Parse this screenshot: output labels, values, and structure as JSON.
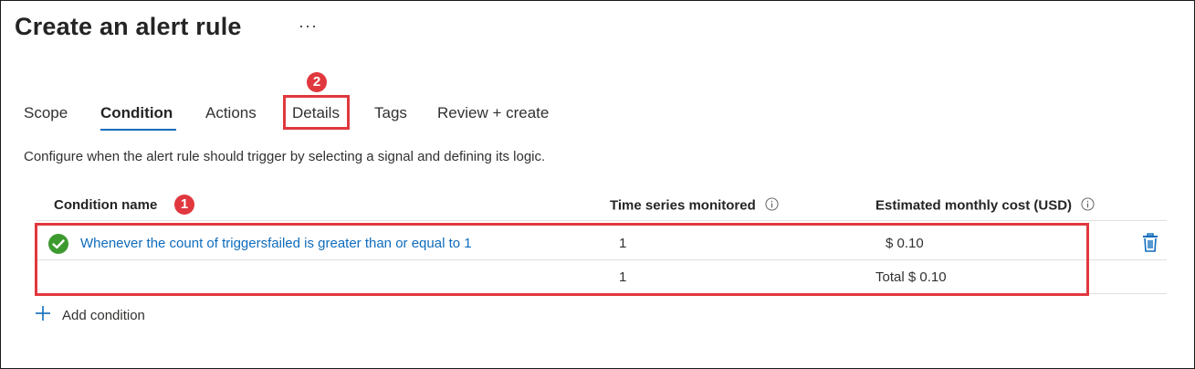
{
  "page": {
    "title": "Create an alert rule",
    "more_label": "···"
  },
  "tabs": [
    {
      "label": "Scope",
      "active": false
    },
    {
      "label": "Condition",
      "active": true
    },
    {
      "label": "Actions",
      "active": false
    },
    {
      "label": "Details",
      "active": false
    },
    {
      "label": "Tags",
      "active": false
    },
    {
      "label": "Review + create",
      "active": false
    }
  ],
  "description": "Configure when the alert rule should trigger by selecting a signal and defining its logic.",
  "table": {
    "headers": {
      "condition_name": "Condition name",
      "time_series": "Time series monitored",
      "cost": "Estimated monthly cost (USD)"
    },
    "rows": [
      {
        "condition": "Whenever the count of triggersfailed is greater than or equal to 1",
        "time_series": "1",
        "cost": "$ 0.10"
      }
    ],
    "total": {
      "time_series": "1",
      "cost": "Total $ 0.10"
    }
  },
  "add_condition_label": "Add condition",
  "annotations": {
    "badge_1": "1",
    "badge_2": "2"
  },
  "colors": {
    "accent": "#0f6cbd",
    "highlight": "#e0383e",
    "success": "#3d9a2f"
  },
  "icons": [
    "more-icon",
    "info-icon",
    "check-circle-icon",
    "trash-icon",
    "plus-icon"
  ]
}
